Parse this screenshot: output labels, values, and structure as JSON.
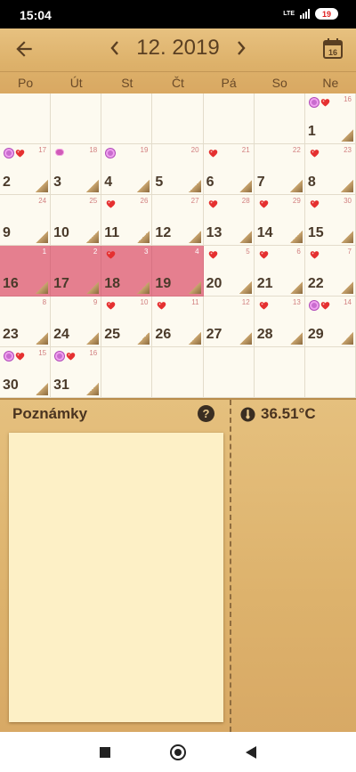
{
  "status": {
    "time": "15:04",
    "network": "LTE",
    "battery": "19"
  },
  "header": {
    "month_title": "12. 2019",
    "today_icon_text": "16"
  },
  "weekdays": [
    "Po",
    "Út",
    "St",
    "Čt",
    "Pá",
    "So",
    "Ne"
  ],
  "calendar": {
    "rows": [
      [
        {
          "day": "",
          "cyc": "",
          "marks": []
        },
        {
          "day": "",
          "cyc": "",
          "marks": []
        },
        {
          "day": "",
          "cyc": "",
          "marks": []
        },
        {
          "day": "",
          "cyc": "",
          "marks": []
        },
        {
          "day": "",
          "cyc": "",
          "marks": []
        },
        {
          "day": "",
          "cyc": "",
          "marks": []
        },
        {
          "day": "1",
          "cyc": "16",
          "marks": [
            "flower",
            "heart"
          ]
        }
      ],
      [
        {
          "day": "2",
          "cyc": "17",
          "marks": [
            "flower",
            "heart"
          ]
        },
        {
          "day": "3",
          "cyc": "18",
          "marks": [
            "pill"
          ]
        },
        {
          "day": "4",
          "cyc": "19",
          "marks": [
            "flower"
          ]
        },
        {
          "day": "5",
          "cyc": "20",
          "marks": []
        },
        {
          "day": "6",
          "cyc": "21",
          "marks": [
            "heart"
          ]
        },
        {
          "day": "7",
          "cyc": "22",
          "marks": []
        },
        {
          "day": "8",
          "cyc": "23",
          "marks": [
            "heart"
          ]
        }
      ],
      [
        {
          "day": "9",
          "cyc": "24",
          "marks": []
        },
        {
          "day": "10",
          "cyc": "25",
          "marks": []
        },
        {
          "day": "11",
          "cyc": "26",
          "marks": [
            "heart"
          ]
        },
        {
          "day": "12",
          "cyc": "27",
          "marks": []
        },
        {
          "day": "13",
          "cyc": "28",
          "marks": [
            "heart"
          ]
        },
        {
          "day": "14",
          "cyc": "29",
          "marks": [
            "heart"
          ]
        },
        {
          "day": "15",
          "cyc": "30",
          "marks": [
            "heart"
          ]
        }
      ],
      [
        {
          "day": "16",
          "cyc": "1",
          "marks": [],
          "period": true
        },
        {
          "day": "17",
          "cyc": "2",
          "marks": [],
          "period": true
        },
        {
          "day": "18",
          "cyc": "3",
          "marks": [
            "heart"
          ],
          "period": true
        },
        {
          "day": "19",
          "cyc": "4",
          "marks": [],
          "period": true
        },
        {
          "day": "20",
          "cyc": "5",
          "marks": [
            "heart"
          ]
        },
        {
          "day": "21",
          "cyc": "6",
          "marks": [
            "heart"
          ]
        },
        {
          "day": "22",
          "cyc": "7",
          "marks": [
            "heart"
          ]
        }
      ],
      [
        {
          "day": "23",
          "cyc": "8",
          "marks": []
        },
        {
          "day": "24",
          "cyc": "9",
          "marks": []
        },
        {
          "day": "25",
          "cyc": "10",
          "marks": [
            "heart"
          ]
        },
        {
          "day": "26",
          "cyc": "11",
          "marks": [
            "heart"
          ]
        },
        {
          "day": "27",
          "cyc": "12",
          "marks": []
        },
        {
          "day": "28",
          "cyc": "13",
          "marks": [
            "heart"
          ]
        },
        {
          "day": "29",
          "cyc": "14",
          "marks": [
            "flower",
            "heart"
          ]
        }
      ],
      [
        {
          "day": "30",
          "cyc": "15",
          "marks": [
            "flower",
            "heart"
          ]
        },
        {
          "day": "31",
          "cyc": "16",
          "marks": [
            "flower",
            "heart"
          ]
        },
        {
          "day": "",
          "cyc": "",
          "marks": []
        },
        {
          "day": "",
          "cyc": "",
          "marks": []
        },
        {
          "day": "",
          "cyc": "",
          "marks": []
        },
        {
          "day": "",
          "cyc": "",
          "marks": []
        },
        {
          "day": "",
          "cyc": "",
          "marks": []
        }
      ]
    ]
  },
  "notes": {
    "title": "Poznámky",
    "help_icon": "?"
  },
  "temperature": {
    "value": "36.51°C"
  },
  "colors": {
    "period": "#e57f8f",
    "heart": "#e53030",
    "leather": "#ddb16a"
  }
}
